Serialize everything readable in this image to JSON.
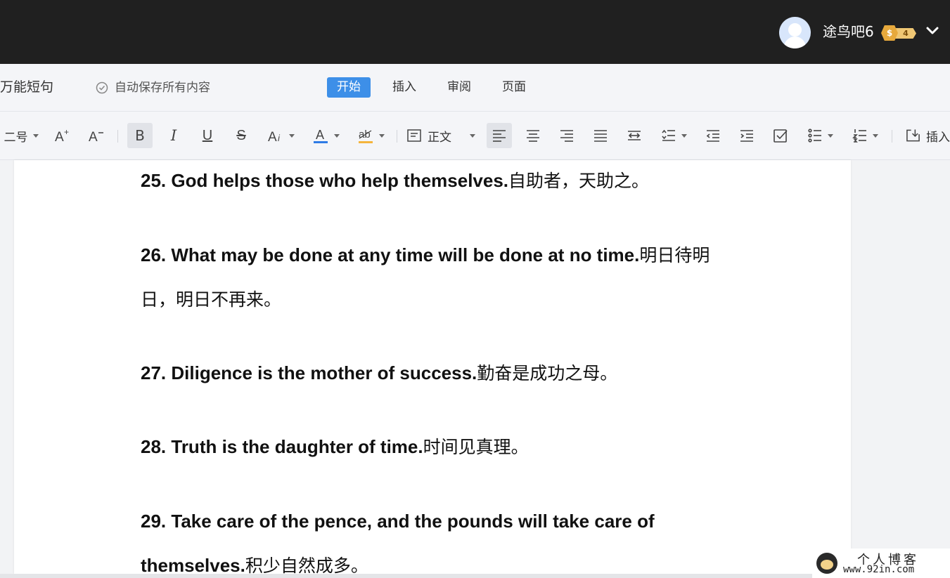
{
  "topbar": {
    "username": "途鸟吧6",
    "badge_coin": "$",
    "badge_level": "4"
  },
  "menubar": {
    "doc_title": "万能短句",
    "autosave": "自动保存所有内容",
    "tabs": [
      {
        "label": "开始",
        "active": true
      },
      {
        "label": "插入",
        "active": false
      },
      {
        "label": "审阅",
        "active": false
      },
      {
        "label": "页面",
        "active": false
      }
    ]
  },
  "toolbar": {
    "font_size": "二号",
    "bold": "B",
    "italic": "I",
    "underline": "U",
    "strike": "S",
    "style_select": "正文",
    "insert": "插入",
    "font_color": "#2f7be5",
    "highlight_color": "#f4b43c"
  },
  "document": {
    "paragraphs": [
      {
        "en": "25. God helps those who help themselves.",
        "zh": "自助者，天助之。"
      },
      {
        "en": "26. What may be done at any time will be done at no time.",
        "zh": "明日待明日，明日不再来。"
      },
      {
        "en": "27. Diligence is the mother of success.",
        "zh": "勤奋是成功之母。"
      },
      {
        "en": "28. Truth is the daughter of time.",
        "zh": "时间见真理。"
      },
      {
        "en": "29. Take care of the pence, and the pounds will take care of themselves.",
        "zh": "积少自然成多。"
      }
    ]
  },
  "watermark": {
    "line1": "个人博客",
    "line2": "www.92in.com"
  }
}
